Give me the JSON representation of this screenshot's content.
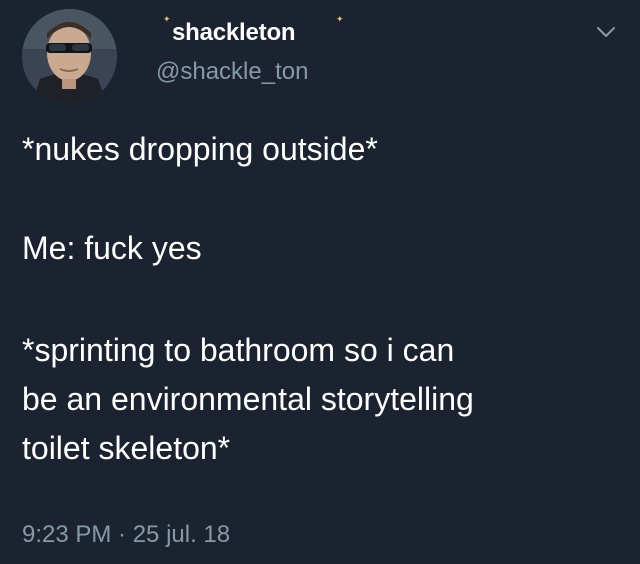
{
  "tweet": {
    "author": {
      "display_name": "shackleton",
      "handle": "@shackle_ton",
      "avatar_icon": "avatar-icon"
    },
    "menu_icon": "chevron-down-icon",
    "lines": [
      "*nukes dropping outside*",
      "Me: fuck yes",
      "*sprinting to bathroom so i can",
      "be an environmental storytelling",
      "toilet skeleton*"
    ],
    "timestamp": "9:23 PM · 25 jul. 18"
  },
  "colors": {
    "background": "#1b2230",
    "text": "#ffffff",
    "secondary_text": "#8899a6"
  }
}
